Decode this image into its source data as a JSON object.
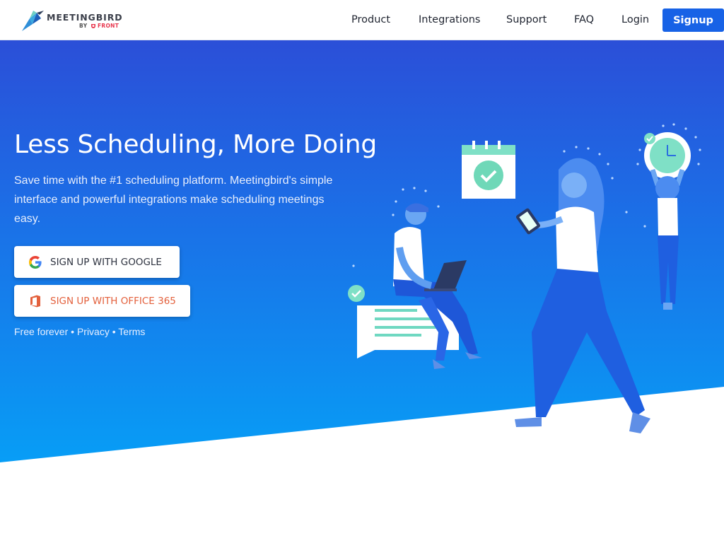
{
  "brand": {
    "name": "MEETINGBIRD",
    "by": "BY",
    "partner": "FRONT"
  },
  "nav": {
    "product": "Product",
    "integrations": "Integrations",
    "support": "Support",
    "faq": "FAQ",
    "login": "Login",
    "signup": "Signup"
  },
  "hero": {
    "title": "Less Scheduling, More Doing",
    "subtitle": "Save time with the #1 scheduling platform. Meetingbird's simple interface and powerful integrations make scheduling meetings easy.",
    "google_button": "SIGN UP WITH GOOGLE",
    "office_button": "SIGN UP WITH OFFICE 365",
    "free": "Free forever",
    "separator": "•",
    "privacy": "Privacy",
    "terms": "Terms"
  },
  "colors": {
    "accent": "#1762e6",
    "gradient_top": "#2b4fd8",
    "gradient_bottom": "#079ef6",
    "office": "#e3603c",
    "check": "#5dd3b0"
  },
  "icons": [
    "hummingbird-logo-icon",
    "google-icon",
    "office-365-icon",
    "check-icon",
    "calendar-icon",
    "clock-icon"
  ]
}
